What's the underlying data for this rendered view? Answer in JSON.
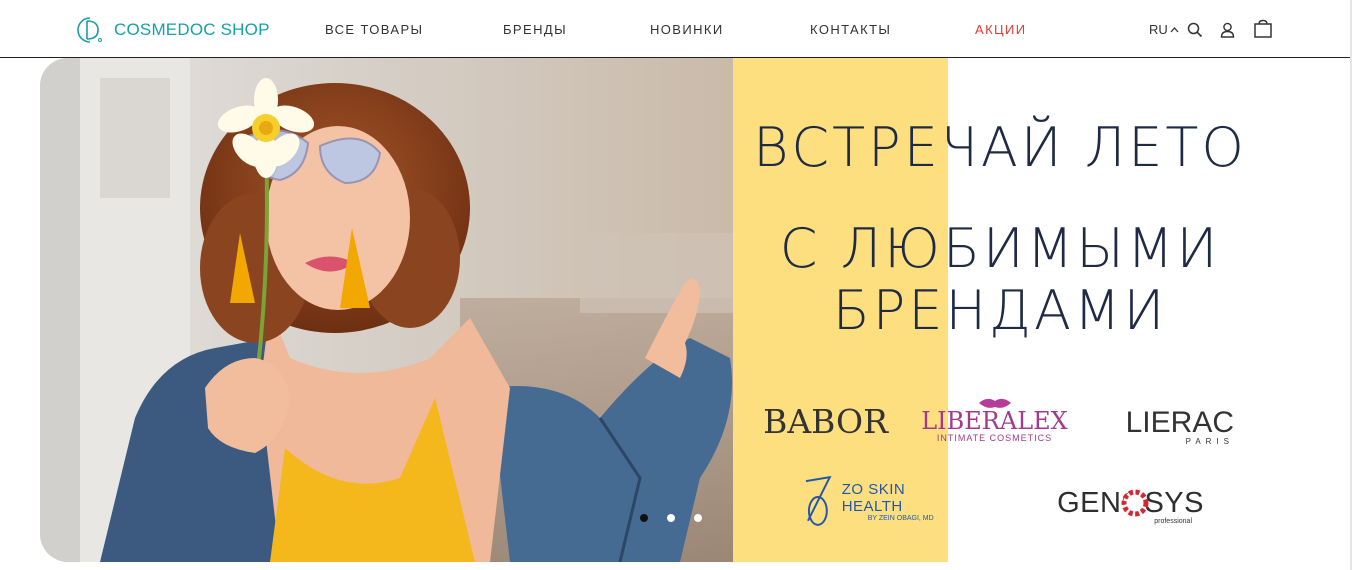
{
  "header": {
    "logo_text": "COSMEDOC SHOP",
    "nav": [
      "ВСЕ ТОВАРЫ",
      "БРЕНДЫ",
      "НОВИНКИ",
      "КОНТАКТЫ",
      "АКЦИИ"
    ],
    "lang": "RU",
    "icons": [
      "search-icon",
      "user-icon",
      "bag-icon"
    ]
  },
  "hero": {
    "headline_line1": "ВСТРЕЧАЙ ЛЕТО",
    "headline_line2": "С ЛЮБИМЫМИ",
    "headline_line3": "БРЕНДАМИ",
    "brands": {
      "babor": "BABOR",
      "liberalex": "LIBERALEX",
      "liberalex_sub": "INTIMATE COSMETICS",
      "lierac": "LIERAC",
      "lierac_sub": "PARIS",
      "zo": "ZO SKIN HEALTH",
      "zo_sub": "BY ZEIN OBAGI, MD",
      "genosys": "GENOSYS",
      "genosys_sub": "professional"
    },
    "slides": 3,
    "active_slide": 1
  },
  "colors": {
    "brand_teal": "#17a0a8",
    "sale_red": "#e53935",
    "headline_navy": "#1f2a44",
    "yellow": "#fddf80"
  }
}
